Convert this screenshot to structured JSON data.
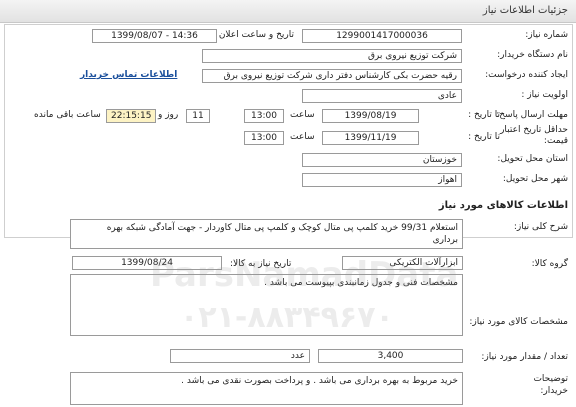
{
  "header": {
    "title": "جزئیات اطلاعات نیاز"
  },
  "details": {
    "need_number_label": "شماره نیاز:",
    "need_number": "1299001417000036",
    "announce_label": "تاریخ و ساعت اعلان عمومی:",
    "announce_value": "1399/08/07 - 14:36",
    "buyer_label": "نام دستگاه خریدار:",
    "buyer_value": "شرکت توزیع نیروی برق",
    "creator_label": "ایجاد کننده درخواست:",
    "creator_value": "رقیه حضرت بکی کارشناس دفتر داری شرکت توزیع نیروی برق",
    "contact_link": "اطلاعات تماس خریدار",
    "priority_label": "اولویت نیاز :",
    "priority_value": "عادی",
    "send_label": "مهلت ارسال پاسخ:",
    "until_date_label": "تا تاریخ :",
    "send_date": "1399/08/19",
    "time_label": "ساعت",
    "send_time": "13:00",
    "days_value": "11",
    "day_and_label": "روز و",
    "remaining_time": "22:15:15",
    "remaining_label": "ساعت باقی مانده",
    "min_price_label_1": "حداقل تاریخ اعتبار",
    "min_price_label_2": "قیمت:",
    "price_date": "1399/11/19",
    "price_time": "13:00",
    "province_label": "استان محل تحویل:",
    "province_value": "خوزستان",
    "city_label": "شهر محل تحویل:",
    "city_value": "اهواز"
  },
  "goods": {
    "section_title": "اطلاعات کالاهای مورد نیاز",
    "summary_label": "شرح کلی نیاز:",
    "summary_line1": "استعلام 99/31  خرید کلمپ پی متال کوچک و کلمپ پی متال کاوردار - جهت آمادگی شبکه بهره",
    "summary_line2": "برداری",
    "group_label": "گروه کالا:",
    "group_value": "ابزارآلات الکتریکی",
    "need_date_label": "تاریخ نیاز به کالا:",
    "need_date": "1399/08/24",
    "specs_label": "مشخصات کالای مورد نیاز:",
    "specs_value": "مشخصات فنی و جدول زمانبندی بپیوست می باشد .",
    "qty_label": "تعداد / مقدار مورد نیاز:",
    "qty_value": "3,400",
    "unit_value": "عدد",
    "buyer_notes_label_1": "توضیحات",
    "buyer_notes_label_2": "خریدار:",
    "buyer_notes_value": "خرید مربوط به بهره برداری می باشد . و پرداخت بصورت نقدی می باشد ."
  },
  "watermark": {
    "brand": "ParsNamadData",
    "phone": "۰۲۱-۸۸۳۴۹۶۷۰"
  }
}
